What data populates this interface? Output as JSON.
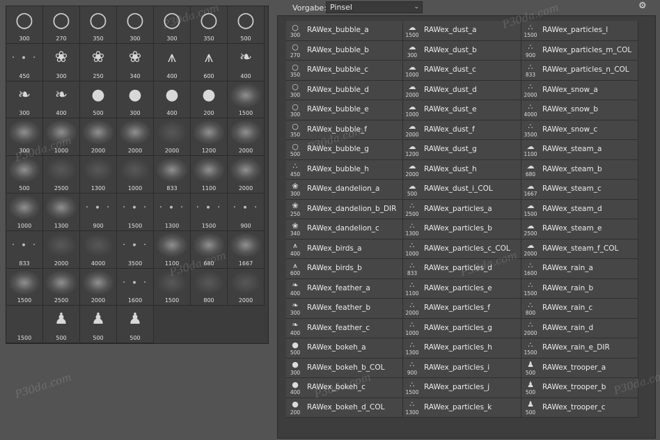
{
  "header": {
    "preset_label": "Vorgabe:",
    "preset_value": "Pinsel",
    "chevron_icon": "chevron-down-icon",
    "settings_icon": "gear-icon"
  },
  "thumbnails": [
    {
      "size": "300",
      "icon": "bubble"
    },
    {
      "size": "270",
      "icon": "bubble"
    },
    {
      "size": "350",
      "icon": "bubble"
    },
    {
      "size": "300",
      "icon": "bubble"
    },
    {
      "size": "300",
      "icon": "bubble"
    },
    {
      "size": "350",
      "icon": "bubble"
    },
    {
      "size": "500",
      "icon": "bubble"
    },
    {
      "size": "450",
      "icon": "dots"
    },
    {
      "size": "300",
      "icon": "dandelion"
    },
    {
      "size": "250",
      "icon": "dandelion"
    },
    {
      "size": "340",
      "icon": "dandelion"
    },
    {
      "size": "400",
      "icon": "birds"
    },
    {
      "size": "600",
      "icon": "birds"
    },
    {
      "size": "400",
      "icon": "feather"
    },
    {
      "size": "300",
      "icon": "feather"
    },
    {
      "size": "400",
      "icon": "feather"
    },
    {
      "size": "500",
      "icon": "bokeh"
    },
    {
      "size": "300",
      "icon": "bokeh"
    },
    {
      "size": "400",
      "icon": "bokeh"
    },
    {
      "size": "200",
      "icon": "bokeh"
    },
    {
      "size": "1500",
      "icon": "soft"
    },
    {
      "size": "300",
      "icon": "soft"
    },
    {
      "size": "1000",
      "icon": "soft"
    },
    {
      "size": "2000",
      "icon": "soft"
    },
    {
      "size": "2000",
      "icon": "soft"
    },
    {
      "size": "2000",
      "icon": "faint"
    },
    {
      "size": "1200",
      "icon": "soft"
    },
    {
      "size": "2000",
      "icon": "soft"
    },
    {
      "size": "500",
      "icon": "soft"
    },
    {
      "size": "2500",
      "icon": "faint"
    },
    {
      "size": "1300",
      "icon": "faint"
    },
    {
      "size": "1000",
      "icon": "faint"
    },
    {
      "size": "833",
      "icon": "soft"
    },
    {
      "size": "1100",
      "icon": "soft"
    },
    {
      "size": "2000",
      "icon": "soft"
    },
    {
      "size": "1000",
      "icon": "soft"
    },
    {
      "size": "1300",
      "icon": "soft"
    },
    {
      "size": "900",
      "icon": "dots"
    },
    {
      "size": "1500",
      "icon": "dots"
    },
    {
      "size": "1300",
      "icon": "dots"
    },
    {
      "size": "1500",
      "icon": "dots"
    },
    {
      "size": "900",
      "icon": "dots"
    },
    {
      "size": "833",
      "icon": "dots"
    },
    {
      "size": "2000",
      "icon": "faint"
    },
    {
      "size": "4000",
      "icon": "faint"
    },
    {
      "size": "3500",
      "icon": "dots"
    },
    {
      "size": "1100",
      "icon": "soft"
    },
    {
      "size": "680",
      "icon": "soft"
    },
    {
      "size": "1667",
      "icon": "soft"
    },
    {
      "size": "1500",
      "icon": "soft"
    },
    {
      "size": "2500",
      "icon": "soft"
    },
    {
      "size": "2000",
      "icon": "soft"
    },
    {
      "size": "1600",
      "icon": "dots"
    },
    {
      "size": "1500",
      "icon": "faint"
    },
    {
      "size": "800",
      "icon": "faint"
    },
    {
      "size": "2000",
      "icon": "faint"
    },
    {
      "size": "1500",
      "icon": "none"
    },
    {
      "size": "500",
      "icon": "trooper"
    },
    {
      "size": "500",
      "icon": "trooper"
    },
    {
      "size": "500",
      "icon": "trooper"
    }
  ],
  "brushes": [
    {
      "name": "RAWex_bubble_a",
      "size": "300",
      "icon": "bubble"
    },
    {
      "name": "RAWex_bubble_b",
      "size": "270",
      "icon": "bubble"
    },
    {
      "name": "RAWex_bubble_c",
      "size": "350",
      "icon": "bubble"
    },
    {
      "name": "RAWex_bubble_d",
      "size": "300",
      "icon": "bubble"
    },
    {
      "name": "RAWex_bubble_e",
      "size": "300",
      "icon": "bubble"
    },
    {
      "name": "RAWex_bubble_f",
      "size": "350",
      "icon": "bubble"
    },
    {
      "name": "RAWex_bubble_g",
      "size": "500",
      "icon": "bubble"
    },
    {
      "name": "RAWex_bubble_h",
      "size": "450",
      "icon": "dots"
    },
    {
      "name": "RAWex_dandelion_a",
      "size": "300",
      "icon": "dandelion"
    },
    {
      "name": "RAWex_dandelion_b_DIR",
      "size": "250",
      "icon": "dandelion"
    },
    {
      "name": "RAWex_dandelion_c",
      "size": "340",
      "icon": "dandelion"
    },
    {
      "name": "RAWex_birds_a",
      "size": "400",
      "icon": "birds"
    },
    {
      "name": "RAWex_birds_b",
      "size": "600",
      "icon": "birds"
    },
    {
      "name": "RAWex_feather_a",
      "size": "400",
      "icon": "feather"
    },
    {
      "name": "RAWex_feather_b",
      "size": "300",
      "icon": "feather"
    },
    {
      "name": "RAWex_feather_c",
      "size": "400",
      "icon": "feather"
    },
    {
      "name": "RAWex_bokeh_a",
      "size": "500",
      "icon": "bokeh"
    },
    {
      "name": "RAWex_bokeh_b_COL",
      "size": "300",
      "icon": "bokeh"
    },
    {
      "name": "RAWex_bokeh_c",
      "size": "400",
      "icon": "bokeh"
    },
    {
      "name": "RAWex_bokeh_d_COL",
      "size": "200",
      "icon": "bokeh"
    },
    {
      "name": "RAWex_dust_a",
      "size": "1500",
      "icon": "soft"
    },
    {
      "name": "RAWex_dust_b",
      "size": "300",
      "icon": "soft"
    },
    {
      "name": "RAWex_dust_c",
      "size": "1000",
      "icon": "soft"
    },
    {
      "name": "RAWex_dust_d",
      "size": "2000",
      "icon": "soft"
    },
    {
      "name": "RAWex_dust_e",
      "size": "1000",
      "icon": "soft"
    },
    {
      "name": "RAWex_dust_f",
      "size": "2000",
      "icon": "soft"
    },
    {
      "name": "RAWex_dust_g",
      "size": "1200",
      "icon": "soft"
    },
    {
      "name": "RAWex_dust_h",
      "size": "2000",
      "icon": "soft"
    },
    {
      "name": "RAWex_dust_i_COL",
      "size": "500",
      "icon": "soft"
    },
    {
      "name": "RAWex_particles_a",
      "size": "2500",
      "icon": "dots"
    },
    {
      "name": "RAWex_particles_b",
      "size": "1300",
      "icon": "dots"
    },
    {
      "name": "RAWex_particles_c_COL",
      "size": "1000",
      "icon": "dots"
    },
    {
      "name": "RAWex_particles_d",
      "size": "833",
      "icon": "dots"
    },
    {
      "name": "RAWex_particles_e",
      "size": "1100",
      "icon": "dots"
    },
    {
      "name": "RAWex_particles_f",
      "size": "2000",
      "icon": "dots"
    },
    {
      "name": "RAWex_particles_g",
      "size": "1000",
      "icon": "dots"
    },
    {
      "name": "RAWex_particles_h",
      "size": "1300",
      "icon": "dots"
    },
    {
      "name": "RAWex_particles_i",
      "size": "900",
      "icon": "dots"
    },
    {
      "name": "RAWex_particles_j",
      "size": "1500",
      "icon": "dots"
    },
    {
      "name": "RAWex_particles_k",
      "size": "1300",
      "icon": "dots"
    },
    {
      "name": "RAWex_particles_l",
      "size": "1500",
      "icon": "dots"
    },
    {
      "name": "RAWex_particles_m_COL",
      "size": "900",
      "icon": "dots"
    },
    {
      "name": "RAWex_particles_n_COL",
      "size": "833",
      "icon": "dots"
    },
    {
      "name": "RAWex_snow_a",
      "size": "2000",
      "icon": "dots"
    },
    {
      "name": "RAWex_snow_b",
      "size": "4000",
      "icon": "dots"
    },
    {
      "name": "RAWex_snow_c",
      "size": "3500",
      "icon": "dots"
    },
    {
      "name": "RAWex_steam_a",
      "size": "1100",
      "icon": "soft"
    },
    {
      "name": "RAWex_steam_b",
      "size": "680",
      "icon": "soft"
    },
    {
      "name": "RAWex_steam_c",
      "size": "1667",
      "icon": "soft"
    },
    {
      "name": "RAWex_steam_d",
      "size": "1500",
      "icon": "soft"
    },
    {
      "name": "RAWex_steam_e",
      "size": "2500",
      "icon": "soft"
    },
    {
      "name": "RAWex_steam_f_COL",
      "size": "2000",
      "icon": "soft"
    },
    {
      "name": "RAWex_rain_a",
      "size": "1600",
      "icon": "dots"
    },
    {
      "name": "RAWex_rain_b",
      "size": "1500",
      "icon": "dots"
    },
    {
      "name": "RAWex_rain_c",
      "size": "800",
      "icon": "dots"
    },
    {
      "name": "RAWex_rain_d",
      "size": "2000",
      "icon": "dots"
    },
    {
      "name": "RAWex_rain_e_DIR",
      "size": "1500",
      "icon": "dots"
    },
    {
      "name": "RAWex_trooper_a",
      "size": "500",
      "icon": "trooper"
    },
    {
      "name": "RAWex_trooper_b",
      "size": "500",
      "icon": "trooper"
    },
    {
      "name": "RAWex_trooper_c",
      "size": "500",
      "icon": "trooper"
    }
  ],
  "watermark_text": "P30da.com"
}
